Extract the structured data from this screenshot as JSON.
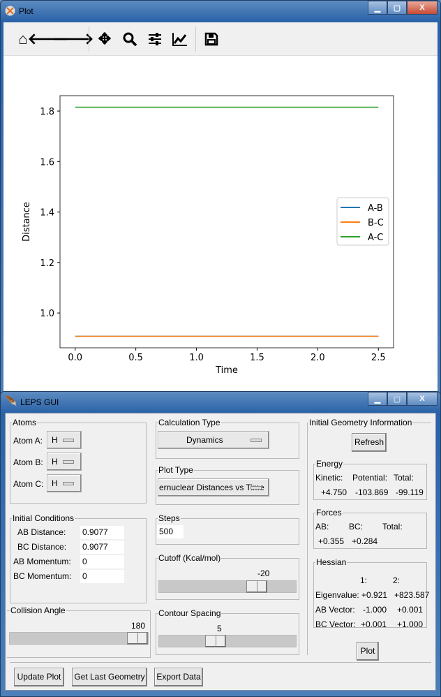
{
  "plot_window": {
    "title": "Plot",
    "toolbar": [
      "home-icon",
      "back-arrow-icon",
      "forward-arrow-icon",
      "pan-icon",
      "zoom-icon",
      "configure-subplots-icon",
      "edit-axes-icon",
      "save-icon"
    ]
  },
  "chart_data": {
    "type": "line",
    "title": "",
    "xlabel": "Time",
    "ylabel": "Distance",
    "xlim": [
      -0.125,
      2.625
    ],
    "ylim": [
      0.862,
      1.861
    ],
    "xticks": [
      "0.0",
      "0.5",
      "1.0",
      "1.5",
      "2.0",
      "2.5"
    ],
    "xtick_values": [
      0,
      0.5,
      1,
      1.5,
      2,
      2.5
    ],
    "yticks": [
      "1.0",
      "1.2",
      "1.4",
      "1.6",
      "1.8"
    ],
    "ytick_values": [
      1.0,
      1.2,
      1.4,
      1.6,
      1.8
    ],
    "legend_placement": "center-right",
    "grid": false,
    "series": [
      {
        "name": "A-B",
        "color": "#1f77b4",
        "x": [
          0,
          2.5
        ],
        "y": [
          0.9077,
          0.9077
        ]
      },
      {
        "name": "B-C",
        "color": "#ff7f0e",
        "x": [
          0,
          2.5
        ],
        "y": [
          0.9077,
          0.9077
        ]
      },
      {
        "name": "A-C",
        "color": "#2ca02c",
        "x": [
          0,
          2.5
        ],
        "y": [
          1.8154,
          1.8154
        ]
      }
    ]
  },
  "leps": {
    "title": "LEPS GUI",
    "atoms": {
      "label": "Atoms",
      "a_label": "Atom A:",
      "a": "H",
      "b_label": "Atom B:",
      "b": "H",
      "c_label": "Atom C:",
      "c": "H"
    },
    "initial": {
      "label": "Initial Conditions",
      "ab_dist_label": "AB Distance:",
      "ab_dist": "0.9077",
      "bc_dist_label": "BC Distance:",
      "bc_dist": "0.9077",
      "ab_mom_label": "AB Momentum:",
      "ab_mom": "0",
      "bc_mom_label": "BC Momentum:",
      "bc_mom": "0"
    },
    "collision": {
      "label": "Collision Angle",
      "value": "180",
      "fraction": 1.0
    },
    "calc": {
      "label": "Calculation Type",
      "value": "Dynamics"
    },
    "plot_type": {
      "label": "Plot Type",
      "value": "ernuclear Distances vs Time"
    },
    "steps": {
      "label": "Steps",
      "value": "500"
    },
    "cutoff": {
      "label": "Cutoff (Kcal/mol)",
      "value": "-20",
      "fraction": 0.75
    },
    "contour": {
      "label": "Contour Spacing",
      "value": "5",
      "fraction": 0.4
    },
    "geom": {
      "label": "Initial Geometry Information",
      "refresh": "Refresh",
      "energy": {
        "label": "Energy",
        "kinetic_label": "Kinetic:",
        "potential_label": "Potential:",
        "total_label": "Total:",
        "kinetic": "+4.750",
        "potential": "-103.869",
        "total": "-99.119"
      },
      "forces": {
        "label": "Forces",
        "ab_label": "AB:",
        "bc_label": "BC:",
        "total_label": "Total:",
        "ab": "+0.355",
        "bc": "+0.284"
      },
      "hessian": {
        "label": "Hessian",
        "col1": "1:",
        "col2": "2:",
        "eig_label": "Eigenvalue:",
        "eig1": "+0.921",
        "eig2": "+823.587",
        "ab_label": "AB Vector:",
        "ab1": "-1.000",
        "ab2": "+0.001",
        "bc_label": "BC Vector:",
        "bc1": "+0.001",
        "bc2": "+1.000"
      },
      "plot": "Plot"
    },
    "buttons": {
      "update": "Update Plot",
      "last_geom": "Get Last Geometry",
      "export": "Export Data"
    }
  }
}
